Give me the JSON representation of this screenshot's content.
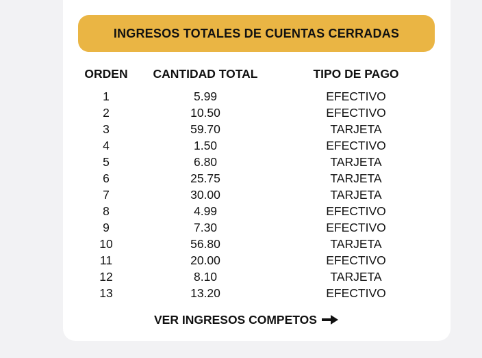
{
  "banner": {
    "title": "INGRESOS TOTALES DE CUENTAS CERRADAS"
  },
  "table": {
    "headers": [
      "ORDEN",
      "CANTIDAD TOTAL",
      "TIPO DE PAGO"
    ],
    "rows": [
      [
        "1",
        "5.99",
        "EFECTIVO"
      ],
      [
        "2",
        "10.50",
        "EFECTIVO"
      ],
      [
        "3",
        "59.70",
        "TARJETA"
      ],
      [
        "4",
        "1.50",
        "EFECTIVO"
      ],
      [
        "5",
        "6.80",
        "TARJETA"
      ],
      [
        "6",
        "25.75",
        "TARJETA"
      ],
      [
        "7",
        "30.00",
        "TARJETA"
      ],
      [
        "8",
        "4.99",
        "EFECTIVO"
      ],
      [
        "9",
        "7.30",
        "EFECTIVO"
      ],
      [
        "10",
        "56.80",
        "TARJETA"
      ],
      [
        "11",
        "20.00",
        "EFECTIVO"
      ],
      [
        "12",
        "8.10",
        "TARJETA"
      ],
      [
        "13",
        "13.20",
        "EFECTIVO"
      ]
    ]
  },
  "footer": {
    "link_label": "VER INGRESOS COMPETOS",
    "link_icon": "arrow-right-icon"
  },
  "colors": {
    "banner": "#eab544",
    "background": "#f2f2f4",
    "card": "#ffffff",
    "text": "#111111"
  }
}
